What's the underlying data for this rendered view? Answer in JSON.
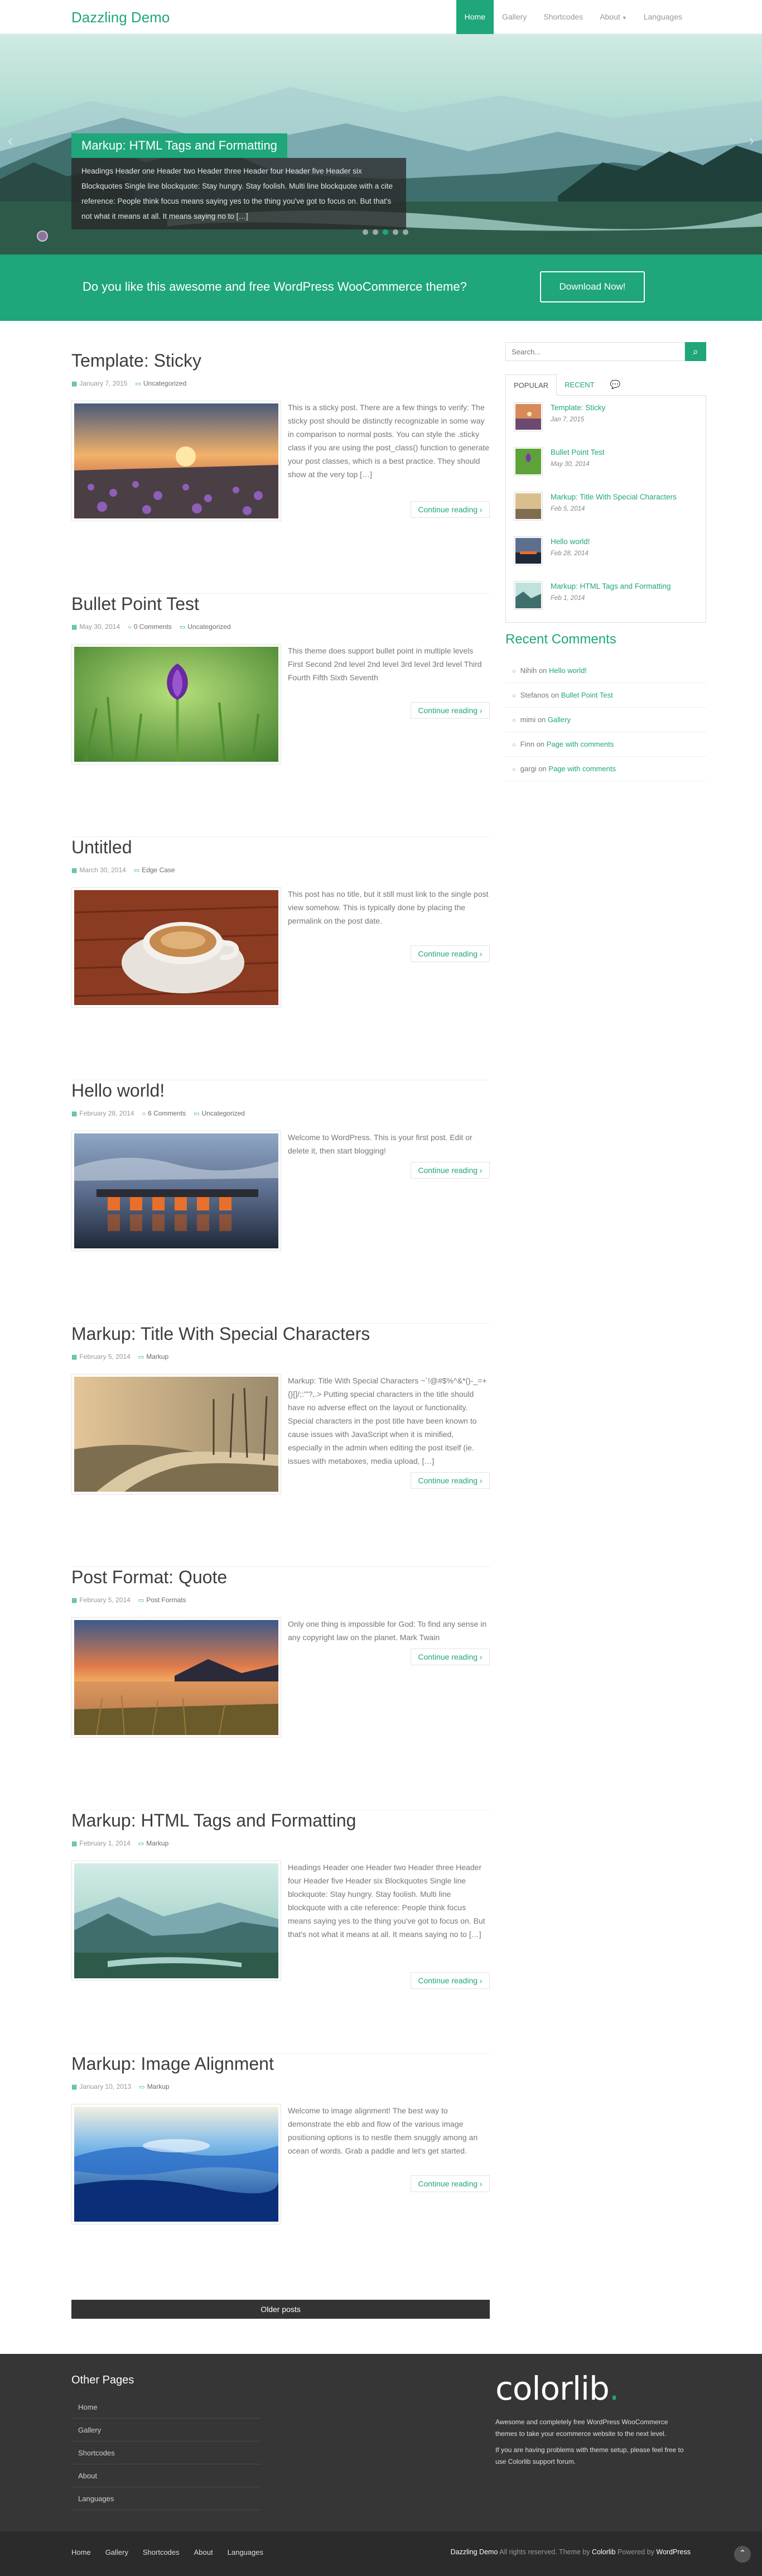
{
  "brand": "Dazzling Demo",
  "nav": {
    "items": [
      {
        "label": "Home",
        "active": true
      },
      {
        "label": "Gallery"
      },
      {
        "label": "Shortcodes"
      },
      {
        "label": "About",
        "dropdown": true
      },
      {
        "label": "Languages"
      }
    ]
  },
  "hero": {
    "title": "Markup: HTML Tags and Formatting",
    "excerpt": "Headings Header one Header two Header three Header four Header five Header six Blockquotes Single line blockquote: Stay hungry. Stay foolish. Multi line blockquote with a cite reference: People think focus means saying yes to the thing you've got to focus on. But that's not what it means at all. It means saying no to […]",
    "prev_icon": "chevron-left-icon",
    "next_icon": "chevron-right-icon"
  },
  "cta": {
    "text": "Do you like this awesome and free WordPress WooCommerce theme?",
    "button": "Download Now!"
  },
  "posts": [
    {
      "title": "Template: Sticky",
      "date": "January 7, 2015",
      "comments": "",
      "category": "Uncategorized",
      "excerpt": "This is a sticky post. There are a few things to verify: The sticky post should be distinctly recognizable in some way in comparison to normal posts. You can style the .sticky class if you are using the post_class() function to generate your post classes, which is a best practice. They should show at the very top […]",
      "read_more": "Continue reading"
    },
    {
      "title": "Bullet Point Test",
      "date": "May 30, 2014",
      "comments": "0 Comments",
      "category": "Uncategorized",
      "excerpt": "This theme does support bullet point in multiple levels First Second 2nd level 2nd level 3rd level 3rd level Third Fourth Fifth Sixth Seventh",
      "read_more": "Continue reading"
    },
    {
      "title": "Untitled",
      "date": "March 30, 2014",
      "comments": "",
      "category": "Edge Case",
      "excerpt": "This post has no title, but it still must link to the single post view somehow. This is typically done by placing the permalink on the post date.",
      "read_more": "Continue reading"
    },
    {
      "title": "Hello world!",
      "date": "February 28, 2014",
      "comments": "6 Comments",
      "category": "Uncategorized",
      "excerpt": "Welcome to WordPress. This is your first post. Edit or delete it, then start blogging!",
      "read_more": "Continue reading"
    },
    {
      "title": "Markup: Title With Special Characters",
      "date": "February 5, 2014",
      "comments": "",
      "category": "Markup",
      "excerpt": "Markup: Title With Special Characters ~`!@#$%^&*()-_=+{}[]/;:'\"?,.> Putting special characters in the title should have no adverse effect on the layout or functionality. Special characters in the post title have been known to cause issues with JavaScript when it is minified, especially in the admin when editing the post itself (ie. issues with metaboxes, media upload, […]",
      "read_more": "Continue reading"
    },
    {
      "title": "Post Format: Quote",
      "date": "February 5, 2014",
      "comments": "",
      "category": "Post Formats",
      "excerpt": "Only one thing is impossible for God: To find any sense in any copyright law on the planet. Mark Twain",
      "read_more": "Continue reading"
    },
    {
      "title": "Markup: HTML Tags and Formatting",
      "date": "February 1, 2014",
      "comments": "",
      "category": "Markup",
      "excerpt": "Headings Header one Header two Header three Header four Header five Header six Blockquotes Single line blockquote: Stay hungry. Stay foolish. Multi line blockquote with a cite reference: People think focus means saying yes to the thing you've got to focus on. But that's not what it means at all. It means saying no to […]",
      "read_more": "Continue reading"
    },
    {
      "title": "Markup: Image Alignment",
      "date": "January 10, 2013",
      "comments": "",
      "category": "Markup",
      "excerpt": "Welcome to image alignment! The best way to demonstrate the ebb and flow of the various image positioning options is to nestle them snuggly among an ocean of words. Grab a paddle and let's get started.",
      "read_more": "Continue reading"
    }
  ],
  "older_posts": "Older posts",
  "sidebar": {
    "search_placeholder": "Search...",
    "search_icon": "search-icon",
    "tabs": [
      "POPULAR",
      "RECENT"
    ],
    "comments_tab_icon": "comments-icon",
    "popular": [
      {
        "title": "Template: Sticky",
        "date": "Jan 7, 2015"
      },
      {
        "title": "Bullet Point Test",
        "date": "May 30, 2014"
      },
      {
        "title": "Markup: Title With Special Characters",
        "date": "Feb 5, 2014"
      },
      {
        "title": "Hello world!",
        "date": "Feb 28, 2014"
      },
      {
        "title": "Markup: HTML Tags and Formatting",
        "date": "Feb 1, 2014"
      }
    ],
    "recent_comments_title": "Recent Comments",
    "recent_comments": [
      {
        "author": "Nihih",
        "on": "on",
        "post": "Hello world!"
      },
      {
        "author": "Stefanos",
        "on": "on",
        "post": "Bullet Point Test"
      },
      {
        "author": "mimi",
        "on": "on",
        "post": "Gallery"
      },
      {
        "author": "Finn",
        "on": "on",
        "post": "Page with comments"
      },
      {
        "author": "gargi",
        "on": "on",
        "post": "Page with comments"
      }
    ]
  },
  "footer": {
    "other_pages_title": "Other Pages",
    "pages": [
      "Home",
      "Gallery",
      "Shortcodes",
      "About",
      "Languages"
    ],
    "logo": "colorlib",
    "logo_dot": ".",
    "desc1": "Awesome and completely free WordPress WooCommerce themes to take your ecommerce website to the next level.",
    "desc2": "If you are having problems with theme setup, please feel free to use Colorlib support forum.",
    "bottom_links": [
      "Home",
      "Gallery",
      "Shortcodes",
      "About",
      "Languages"
    ],
    "copy_site": "Dazzling Demo",
    "copy_rest": "All rights reserved. Theme by",
    "copy_theme": "Colorlib",
    "copy_powered": "Powered by",
    "copy_wp": "WordPress",
    "to_top_icon": "chevron-up-icon"
  },
  "colors": {
    "accent": "#1fa67a",
    "footer": "#363636",
    "footer_bottom": "#2b2b2b"
  }
}
